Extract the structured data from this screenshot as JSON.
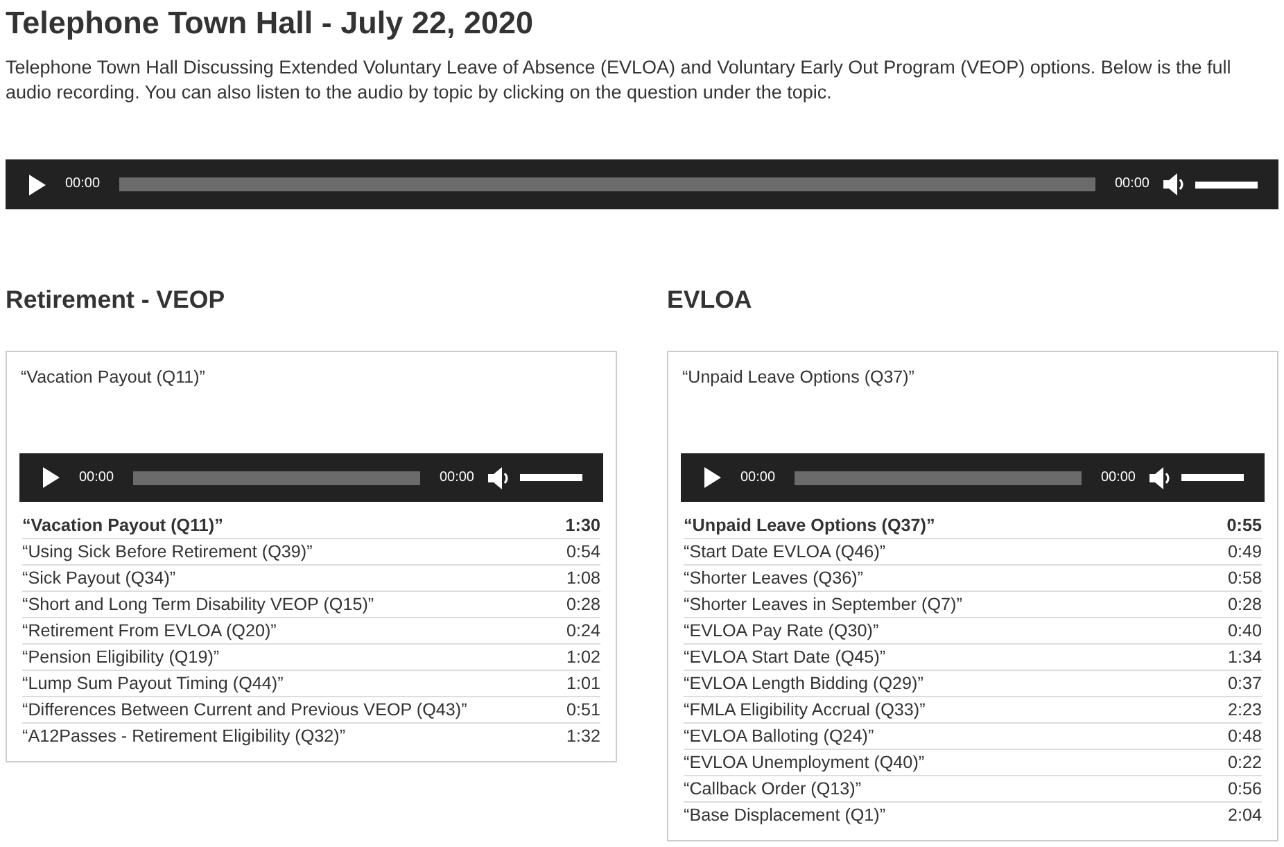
{
  "page": {
    "title": "Telephone Town Hall - July 22, 2020",
    "intro": "Telephone Town Hall Discussing Extended Voluntary Leave of Absence (EVLOA) and Voluntary Early Out Program (VEOP) options. Below is the full audio recording. You can also listen to the audio by topic by clicking on the question under the topic."
  },
  "main_player": {
    "current_time": "00:00",
    "duration": "00:00",
    "volume": {
      "level": 1
    }
  },
  "sections": [
    {
      "heading": "Retirement - VEOP",
      "card": {
        "caption": "“Vacation Payout (Q11)”",
        "player": {
          "current_time": "00:00",
          "duration": "00:00",
          "volume": {
            "level": 1
          }
        },
        "playlist": [
          {
            "title": "“Vacation Payout (Q11)”",
            "duration": "1:30",
            "selected": true
          },
          {
            "title": "“Using Sick Before Retirement (Q39)”",
            "duration": "0:54",
            "selected": false
          },
          {
            "title": "“Sick Payout (Q34)”",
            "duration": "1:08",
            "selected": false
          },
          {
            "title": "“Short and Long Term Disability VEOP (Q15)”",
            "duration": "0:28",
            "selected": false
          },
          {
            "title": "“Retirement From EVLOA (Q20)”",
            "duration": "0:24",
            "selected": false
          },
          {
            "title": "“Pension Eligibility (Q19)”",
            "duration": "1:02",
            "selected": false
          },
          {
            "title": "“Lump Sum Payout Timing (Q44)”",
            "duration": "1:01",
            "selected": false
          },
          {
            "title": "“Differences Between Current and Previous VEOP (Q43)”",
            "duration": "0:51",
            "selected": false
          },
          {
            "title": "“A12Passes - Retirement Eligibility (Q32)”",
            "duration": "1:32",
            "selected": false
          }
        ]
      }
    },
    {
      "heading": "EVLOA",
      "card": {
        "caption": "“Unpaid Leave Options (Q37)”",
        "player": {
          "current_time": "00:00",
          "duration": "00:00",
          "volume": {
            "level": 1
          }
        },
        "playlist": [
          {
            "title": "“Unpaid Leave Options (Q37)”",
            "duration": "0:55",
            "selected": true
          },
          {
            "title": "“Start Date EVLOA (Q46)”",
            "duration": "0:49",
            "selected": false
          },
          {
            "title": "“Shorter Leaves (Q36)”",
            "duration": "0:58",
            "selected": false
          },
          {
            "title": "“Shorter Leaves in September (Q7)”",
            "duration": "0:28",
            "selected": false
          },
          {
            "title": "“EVLOA Pay Rate (Q30)”",
            "duration": "0:40",
            "selected": false
          },
          {
            "title": "“EVLOA Start Date (Q45)”",
            "duration": "1:34",
            "selected": false
          },
          {
            "title": "“EVLOA Length Bidding (Q29)”",
            "duration": "0:37",
            "selected": false
          },
          {
            "title": "“FMLA Eligibility Accrual (Q33)”",
            "duration": "2:23",
            "selected": false
          },
          {
            "title": "“EVLOA Balloting (Q24)”",
            "duration": "0:48",
            "selected": false
          },
          {
            "title": "“EVLOA Unemployment (Q40)”",
            "duration": "0:22",
            "selected": false
          },
          {
            "title": "“Callback Order (Q13)”",
            "duration": "0:56",
            "selected": false
          },
          {
            "title": "“Base Displacement (Q1)”",
            "duration": "2:04",
            "selected": false
          }
        ]
      }
    }
  ]
}
